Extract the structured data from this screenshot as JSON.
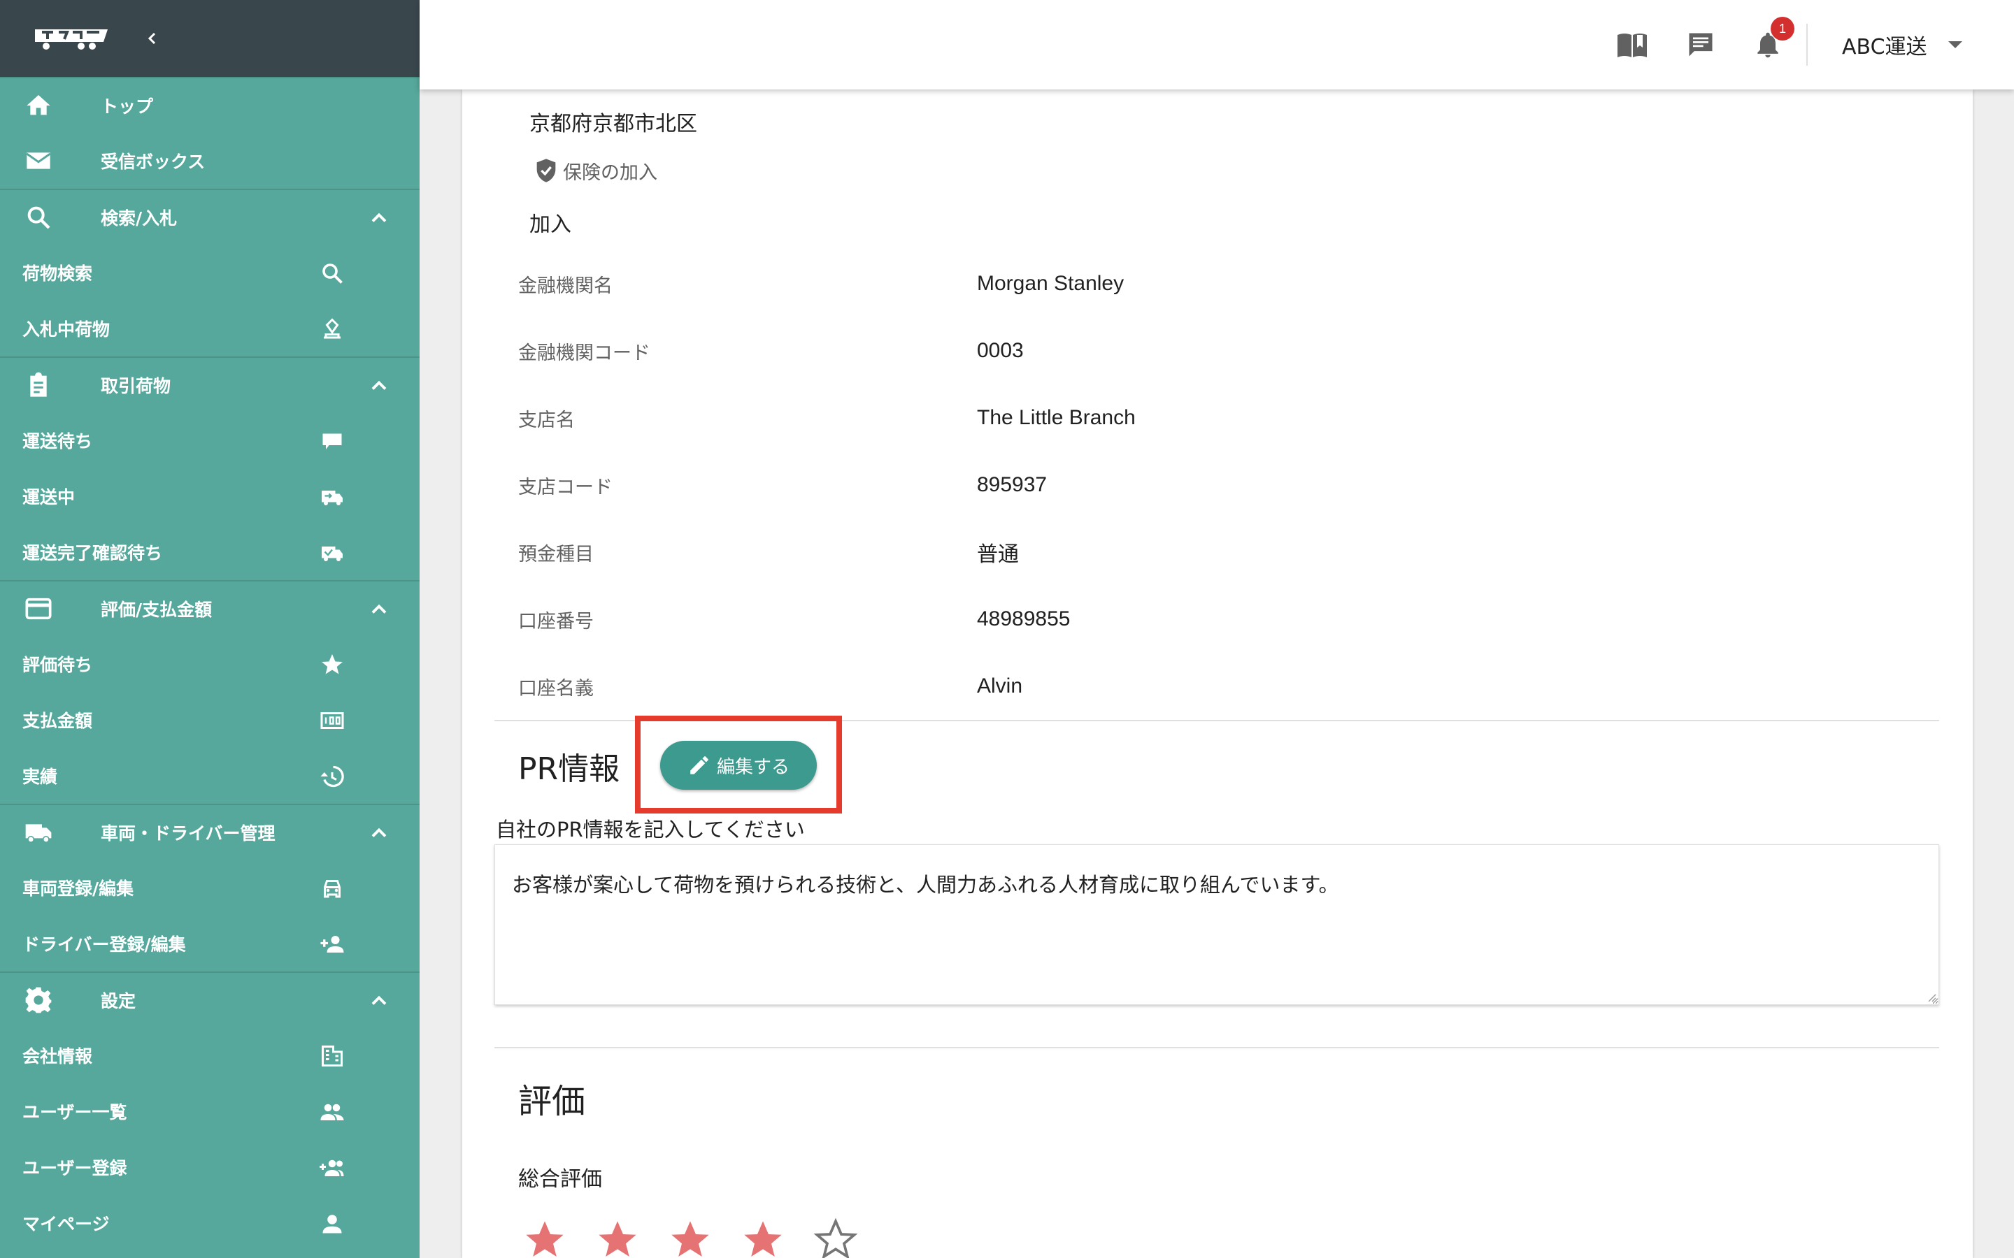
{
  "sidebar": {
    "nav": [
      {
        "type": "row",
        "label": "トップ",
        "icon": "home-icon"
      },
      {
        "type": "row",
        "label": "受信ボックス",
        "icon": "mail-icon"
      },
      {
        "type": "section",
        "label": "検索/入札",
        "icon": "search-icon"
      },
      {
        "type": "sub",
        "label": "荷物検索",
        "icon": "search-icon"
      },
      {
        "type": "sub",
        "label": "入札中荷物",
        "icon": "bid-icon"
      },
      {
        "type": "section",
        "label": "取引荷物",
        "icon": "clipboard-icon"
      },
      {
        "type": "sub",
        "label": "運送待ち",
        "icon": "truck-waiting-icon"
      },
      {
        "type": "sub",
        "label": "運送中",
        "icon": "truck-moving-icon"
      },
      {
        "type": "sub",
        "label": "運送完了確認待ち",
        "icon": "truck-check-icon"
      },
      {
        "type": "section",
        "label": "評価/支払金額",
        "icon": "credit-card-icon"
      },
      {
        "type": "sub",
        "label": "評価待ち",
        "icon": "star-icon"
      },
      {
        "type": "sub",
        "label": "支払金額",
        "icon": "money-icon"
      },
      {
        "type": "sub",
        "label": "実績",
        "icon": "history-icon"
      },
      {
        "type": "section",
        "label": "車両・ドライバー管理",
        "icon": "truck-icon"
      },
      {
        "type": "sub",
        "label": "車両登録/編集",
        "icon": "car-icon"
      },
      {
        "type": "sub",
        "label": "ドライバー登録/編集",
        "icon": "person-add-icon"
      },
      {
        "type": "section",
        "label": "設定",
        "icon": "gear-icon"
      },
      {
        "type": "sub",
        "label": "会社情報",
        "icon": "building-icon"
      },
      {
        "type": "sub",
        "label": "ユーザー一覧",
        "icon": "people-icon"
      },
      {
        "type": "sub",
        "label": "ユーザー登録",
        "icon": "group-add-icon"
      },
      {
        "type": "sub",
        "label": "マイページ",
        "icon": "person-icon"
      }
    ]
  },
  "topbar": {
    "notification_count": "1",
    "account_name": "ABC運送"
  },
  "company": {
    "address": "京都府京都市北区",
    "insurance_label": "保険の加入",
    "insurance_value": "加入"
  },
  "bank": [
    {
      "label": "金融機関名",
      "value": "Morgan Stanley"
    },
    {
      "label": "金融機関コード",
      "value": "0003"
    },
    {
      "label": "支店名",
      "value": "The Little Branch"
    },
    {
      "label": "支店コード",
      "value": "895937"
    },
    {
      "label": "預金種目",
      "value": "普通"
    },
    {
      "label": "口座番号",
      "value": "48989855"
    },
    {
      "label": "口座名義",
      "value": "Alvin"
    }
  ],
  "pr": {
    "title": "PR情報",
    "edit_label": "編集する",
    "field_label": "自社のPR情報を記入してください",
    "text": "お客様が案心して荷物を預けられる技術と、人間力あふれる人材育成に取り組んでいます。"
  },
  "evaluation": {
    "title": "評価",
    "overall_label": "総合評価",
    "rating": 4,
    "max": 5
  },
  "colors": {
    "sidebar": "#55a89b",
    "sidebar_header": "#39474d",
    "accent": "#3d9a8e",
    "highlight": "#e53b2c",
    "star": "#e57373"
  }
}
